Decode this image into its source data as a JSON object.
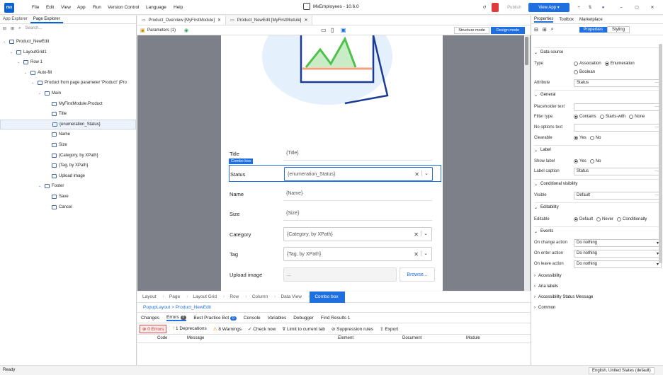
{
  "app": {
    "logo": "mx",
    "title": "MxEmployees - 10.6.0",
    "menu": [
      "File",
      "Edit",
      "View",
      "App",
      "Run",
      "Version Control",
      "Language",
      "Help"
    ],
    "publish": "Publish",
    "view_app": "View App"
  },
  "left": {
    "tabs": [
      "App Explorer",
      "Page Explorer"
    ],
    "search_placeholder": "Search...",
    "tree": [
      {
        "label": "Product_NewEdit",
        "depth": 0
      },
      {
        "label": "LayoutGrid1",
        "depth": 1
      },
      {
        "label": "Row 1",
        "depth": 2
      },
      {
        "label": "Auto-fill",
        "depth": 3
      },
      {
        "label": "Product from page parameter 'Product' (Pro",
        "depth": 4
      },
      {
        "label": "Main",
        "depth": 5
      },
      {
        "label": "MyFirstModule.Product",
        "depth": 6
      },
      {
        "label": "Title",
        "depth": 6
      },
      {
        "label": "{enumeration_Status}",
        "depth": 6
      },
      {
        "label": "Name",
        "depth": 6
      },
      {
        "label": "Size",
        "depth": 6
      },
      {
        "label": "{Category, by XPath}",
        "depth": 6
      },
      {
        "label": "{Tag, by XPath}",
        "depth": 6
      },
      {
        "label": "Upload image",
        "depth": 6
      },
      {
        "label": "Footer",
        "depth": 5
      },
      {
        "label": "Save",
        "depth": 6
      },
      {
        "label": "Cancel",
        "depth": 6
      }
    ]
  },
  "center": {
    "tabs": [
      "Product_Overview [MyFirstModule]",
      "Product_NewEdit [MyFirstModule]"
    ],
    "parameters": "Parameters (1)",
    "structure_mode": "Structure mode",
    "design_mode": "Design mode",
    "combo_tag": "Combo box",
    "fields": [
      {
        "label": "Title",
        "value": "{Title}",
        "type": "text"
      },
      {
        "label": "Status",
        "value": "{enumeration_Status}",
        "type": "combo"
      },
      {
        "label": "Name",
        "value": "{Name}",
        "type": "text"
      },
      {
        "label": "Size",
        "value": "{Size}",
        "type": "text"
      },
      {
        "label": "Category",
        "value": "{Category, by XPath}",
        "type": "combo"
      },
      {
        "label": "Tag",
        "value": "{Tag, by XPath}",
        "type": "combo"
      },
      {
        "label": "Upload image",
        "value": "...",
        "type": "upload"
      }
    ],
    "browse": "Browse...",
    "breadcrumb": [
      "Layout",
      "Page",
      "Layout Grid",
      "Row",
      "Column",
      "Data View",
      "Combo box"
    ],
    "path": "PopupLayout  >  Product_NewEdit"
  },
  "bottom": {
    "tabs": [
      "Changes",
      "Errors",
      "Best Practice Bot",
      "Console",
      "Variables",
      "Debugger",
      "Find Results 1"
    ],
    "errors_count": "0",
    "bpb_count": "0",
    "tools": [
      "0 Errors",
      "1 Deprecations",
      "8 Warnings",
      "Check now",
      "Limit to current tab",
      "Suppression rules",
      "Export"
    ],
    "columns": [
      "Code",
      "Message",
      "Element",
      "Document",
      "Module"
    ]
  },
  "right": {
    "tabs": [
      "Properties",
      "Toolbox",
      "Marketplace"
    ],
    "subtabs": [
      "Properties",
      "Styling"
    ],
    "sections": {
      "data_source": "Data source",
      "general": "General",
      "label": "Label",
      "cond": "Conditional visibility",
      "editability": "Editability",
      "events": "Events"
    },
    "type_label": "Type",
    "type_opts": [
      "Association",
      "Enumeration",
      "Boolean"
    ],
    "attribute_label": "Attribute",
    "attribute_val": "Status",
    "placeholder_label": "Placeholder text",
    "filter_label": "Filter type",
    "filter_opts": [
      "Contains",
      "Starts-with",
      "None"
    ],
    "nooptions_label": "No options text",
    "clearable_label": "Clearable",
    "yes": "Yes",
    "no": "No",
    "showlabel_label": "Show label",
    "labelcaption_label": "Label caption",
    "labelcaption_val": "Status",
    "visible_label": "Visible",
    "visible_val": "Default",
    "editable_label": "Editable",
    "editable_opts": [
      "Default",
      "Never",
      "Conditionally"
    ],
    "events": [
      {
        "label": "On change action",
        "val": "Do nothing"
      },
      {
        "label": "On enter action",
        "val": "Do nothing"
      },
      {
        "label": "On leave action",
        "val": "Do nothing"
      }
    ],
    "collapsed": [
      "Accessibility",
      "Aria labels",
      "Accessibility Status Message",
      "Common"
    ]
  },
  "status": {
    "left": "Ready",
    "right": "English, United States (default)"
  }
}
